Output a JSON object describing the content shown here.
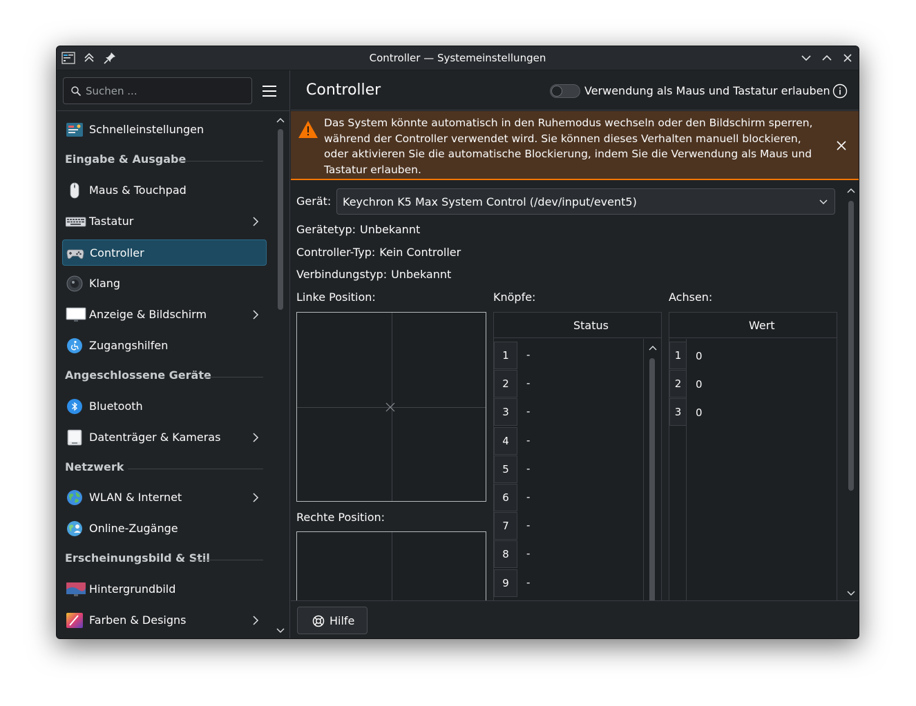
{
  "window": {
    "title": "Controller — Systemeinstellungen"
  },
  "search": {
    "placeholder": "Suchen ..."
  },
  "sidebar": {
    "items": [
      {
        "label": "Schnelleinstellungen",
        "icon": "quick-settings-icon"
      },
      {
        "label": "Maus & Touchpad",
        "icon": "mouse-icon"
      },
      {
        "label": "Tastatur",
        "icon": "keyboard-icon"
      },
      {
        "label": "Controller",
        "icon": "gamepad-icon",
        "active": true
      },
      {
        "label": "Klang",
        "icon": "speaker-icon"
      },
      {
        "label": "Anzeige & Bildschirm",
        "icon": "display-icon"
      },
      {
        "label": "Zugangshilfen",
        "icon": "accessibility-icon"
      },
      {
        "label": "Bluetooth",
        "icon": "bluetooth-icon"
      },
      {
        "label": "Datenträger & Kameras",
        "icon": "drive-icon"
      },
      {
        "label": "WLAN & Internet",
        "icon": "network-globe-icon"
      },
      {
        "label": "Online-Zugänge",
        "icon": "online-accounts-icon"
      },
      {
        "label": "Hintergrundbild",
        "icon": "wallpaper-icon"
      },
      {
        "label": "Farben & Designs",
        "icon": "colors-icon"
      }
    ],
    "categories": [
      "Eingabe & Ausgabe",
      "Angeschlossene Geräte",
      "Netzwerk",
      "Erscheinungsbild & Stil"
    ]
  },
  "main": {
    "title": "Controller",
    "toggle_label": "Verwendung als Maus und Tastatur erlauben",
    "toggle_on": false,
    "warning_text": "Das System könnte automatisch in den Ruhemodus wechseln oder den Bildschirm sperren, während der Controller verwendet wird. Sie können dieses Verhalten manuell blockieren, oder aktivieren Sie die automatische Blockierung, indem Sie die Verwendung als Maus und Tastatur erlauben.",
    "device_label": "Gerät:",
    "device_value": "Keychron K5 Max System Control (/dev/input/event5)",
    "device_type_label": "Gerätetyp:",
    "device_type_value": "Unbekannt",
    "controller_type_label": "Controller-Typ:",
    "controller_type_value": "Kein Controller",
    "connection_type_label": "Verbindungstyp:",
    "connection_type_value": "Unbekannt",
    "left_position_label": "Linke Position:",
    "right_position_label": "Rechte Position:",
    "buttons_label": "Knöpfe:",
    "axes_label": "Achsen:",
    "buttons_header": "Status",
    "axes_header": "Wert",
    "buttons": [
      {
        "n": "1",
        "v": "-"
      },
      {
        "n": "2",
        "v": "-"
      },
      {
        "n": "3",
        "v": "-"
      },
      {
        "n": "4",
        "v": "-"
      },
      {
        "n": "5",
        "v": "-"
      },
      {
        "n": "6",
        "v": "-"
      },
      {
        "n": "7",
        "v": "-"
      },
      {
        "n": "8",
        "v": "-"
      },
      {
        "n": "9",
        "v": "-"
      }
    ],
    "axes": [
      {
        "n": "1",
        "v": "0"
      },
      {
        "n": "2",
        "v": "0"
      },
      {
        "n": "3",
        "v": "0"
      }
    ],
    "help_label": "Hilfe"
  },
  "colors": {
    "accent": "#3daee9",
    "selection": "#1d4a60",
    "warning_bg": "#4d3421",
    "warning_border": "#f67400"
  }
}
